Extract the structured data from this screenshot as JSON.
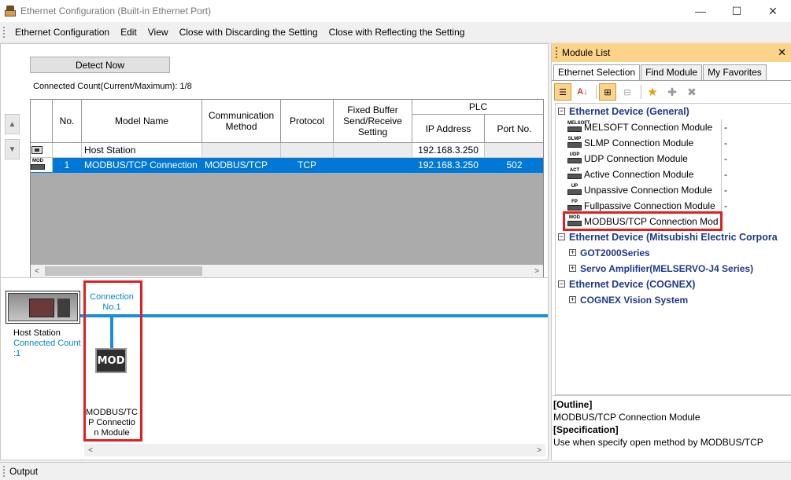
{
  "window": {
    "title": "Ethernet Configuration (Built-in Ethernet Port)",
    "minimize": "—",
    "maximize": "☐",
    "close": "✕"
  },
  "menu": [
    "Ethernet Configuration",
    "Edit",
    "View",
    "Close with Discarding the Setting",
    "Close with Reflecting the Setting"
  ],
  "config": {
    "detect_button": "Detect Now",
    "connected_count": "Connected Count(Current/Maximum):  1/8"
  },
  "grid": {
    "headers": {
      "no": "No.",
      "model": "Model Name",
      "comm": "Communication\nMethod",
      "protocol": "Protocol",
      "fixed": "Fixed Buffer\nSend/Receive\nSetting",
      "plc": "PLC",
      "ip": "IP Address",
      "port": "Port No."
    },
    "rows": [
      {
        "no": "",
        "model": "Host Station",
        "comm": "",
        "protocol": "",
        "fixed": "",
        "ip": "192.168.3.250",
        "port": ""
      },
      {
        "no": "1",
        "model": "MODBUS/TCP Connection",
        "comm": "MODBUS/TCP",
        "protocol": "TCP",
        "fixed": "",
        "ip": "192.168.3.250",
        "port": "502"
      }
    ]
  },
  "diagram": {
    "host_label": "Host Station",
    "host_count": "Connected Count\n:1",
    "connection_label": "Connection\nNo.1",
    "mod_text": "MOD",
    "mod_label": "MODBUS/TC\nP Connectio\nn Module"
  },
  "module_list": {
    "title": "Module List",
    "tabs": [
      "Ethernet Selection",
      "Find Module",
      "My Favorites"
    ],
    "tree": {
      "cat_general": "Ethernet Device (General)",
      "leaves": [
        {
          "icon": "MELSOFT",
          "name": "MELSOFT Connection Module",
          "value": "-"
        },
        {
          "icon": "SLMP",
          "name": "SLMP Connection Module",
          "value": "-"
        },
        {
          "icon": "UDP",
          "name": "UDP Connection Module",
          "value": "-"
        },
        {
          "icon": "ACT",
          "name": "Active Connection Module",
          "value": "-"
        },
        {
          "icon": "UP",
          "name": "Unpassive Connection Module",
          "value": "-"
        },
        {
          "icon": "FP",
          "name": "Fullpassive Connection Module",
          "value": "-"
        },
        {
          "icon": "MOD",
          "name": "MODBUS/TCP Connection Mod",
          "value": ""
        }
      ],
      "cat_mitsubishi": "Ethernet Device (Mitsubishi Electric Corpora",
      "sub_got": "GOT2000Series",
      "sub_servo": "Servo Amplifier(MELSERVO-J4 Series)",
      "cat_cognex": "Ethernet Device (COGNEX)",
      "sub_cognex": "COGNEX Vision System"
    },
    "outline_header": "[Outline]",
    "outline_text": "MODBUS/TCP Connection Module",
    "spec_header": "[Specification]",
    "spec_text": "Use when specify open method by MODBUS/TCP"
  },
  "output": {
    "title": "Output"
  }
}
